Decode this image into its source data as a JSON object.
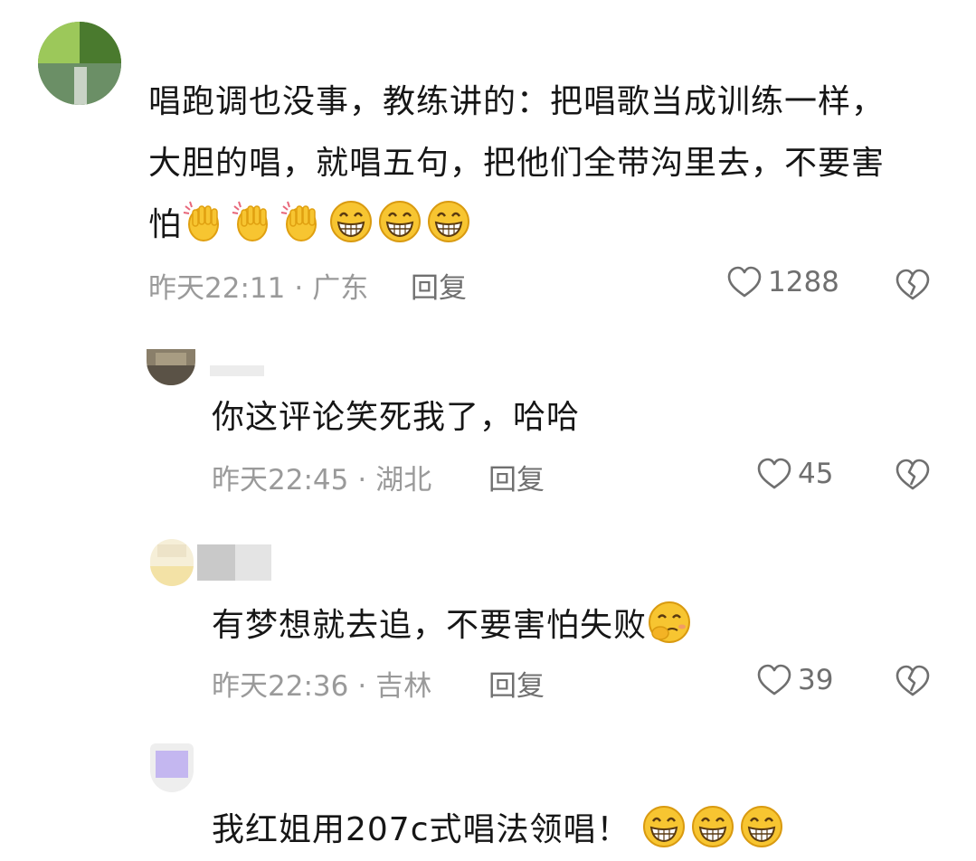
{
  "comments": [
    {
      "text_lines": [
        "唱跑调也没事，教练讲的：把唱歌当成训练一样，",
        "大胆的唱，就唱五句，把他们全带沟里去，不要害",
        "怕"
      ],
      "emojis": [
        "clap-icon",
        "clap-icon",
        "clap-icon",
        "grin-icon",
        "grin-icon",
        "grin-icon"
      ],
      "time": "昨天22:11",
      "location": "广东",
      "reply_label": "回复",
      "likes": "1288"
    },
    {
      "text_lines": [
        "你这评论笑死我了，哈哈"
      ],
      "time": "昨天22:45",
      "location": "湖北",
      "reply_label": "回复",
      "likes": "45"
    },
    {
      "text_lines": [
        "有梦想就去追，不要害怕失败"
      ],
      "emojis": [
        "giggle-icon"
      ],
      "time": "昨天22:36",
      "location": "吉林",
      "reply_label": "回复",
      "likes": "39"
    },
    {
      "text_lines": [
        "我红姐用207c式唱法领唱！"
      ],
      "emojis": [
        "grin-icon",
        "grin-icon",
        "grin-icon"
      ]
    }
  ],
  "separator": "·",
  "colors": {
    "meta_gray": "#9a9a9a",
    "text": "#161616",
    "emoji_yellow": "#f7c531"
  }
}
